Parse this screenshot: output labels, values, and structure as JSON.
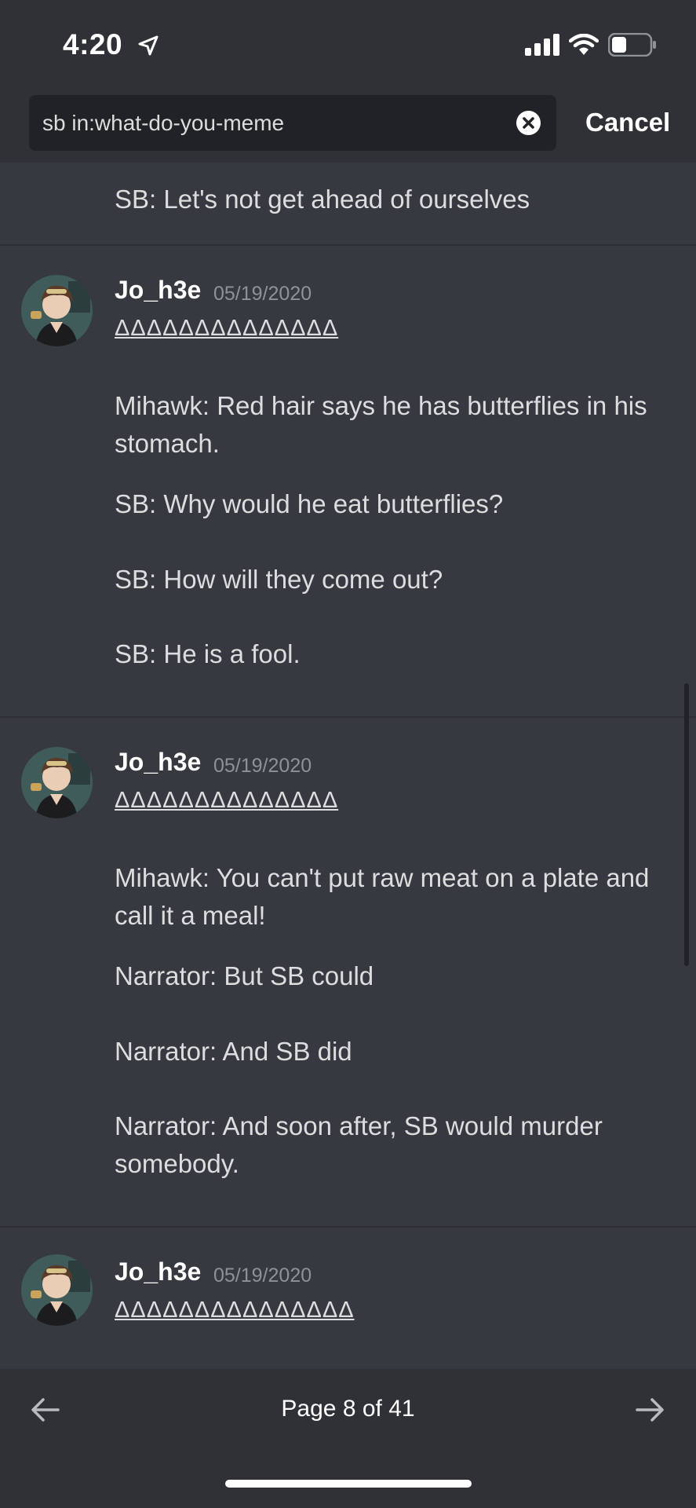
{
  "status_bar": {
    "time": "4:20"
  },
  "search": {
    "query": "sb in:what-do-you-meme",
    "cancel_label": "Cancel"
  },
  "results": [
    {
      "lines": [
        "SB: Let's not get ahead of ourselves"
      ]
    },
    {
      "username": "Jo_h3e",
      "date": "05/19/2020",
      "glyph": "ΔΔΔΔΔΔΔΔΔΔΔΔΔΔ",
      "lines": [
        "Mihawk: Red hair says he has butterflies in his stomach.",
        "SB: Why would he eat butterflies?",
        "SB: How will they come out?",
        "SB: He is a fool."
      ]
    },
    {
      "username": "Jo_h3e",
      "date": "05/19/2020",
      "glyph": "ΔΔΔΔΔΔΔΔΔΔΔΔΔΔ",
      "lines": [
        "Mihawk: You can't put raw meat on a plate and call it a meal!",
        "Narrator: But SB could",
        "Narrator: And SB did",
        "Narrator: And soon after, SB would murder somebody."
      ]
    },
    {
      "username": "Jo_h3e",
      "date": "05/19/2020",
      "glyph": "ΔΔΔΔΔΔΔΔΔΔΔΔΔΔΔ",
      "lines": []
    }
  ],
  "pagination": {
    "label": "Page 8 of 41"
  },
  "colors": {
    "background": "#36393f",
    "header": "#2f3136",
    "search_field": "#202225",
    "muted": "#8e9297"
  }
}
